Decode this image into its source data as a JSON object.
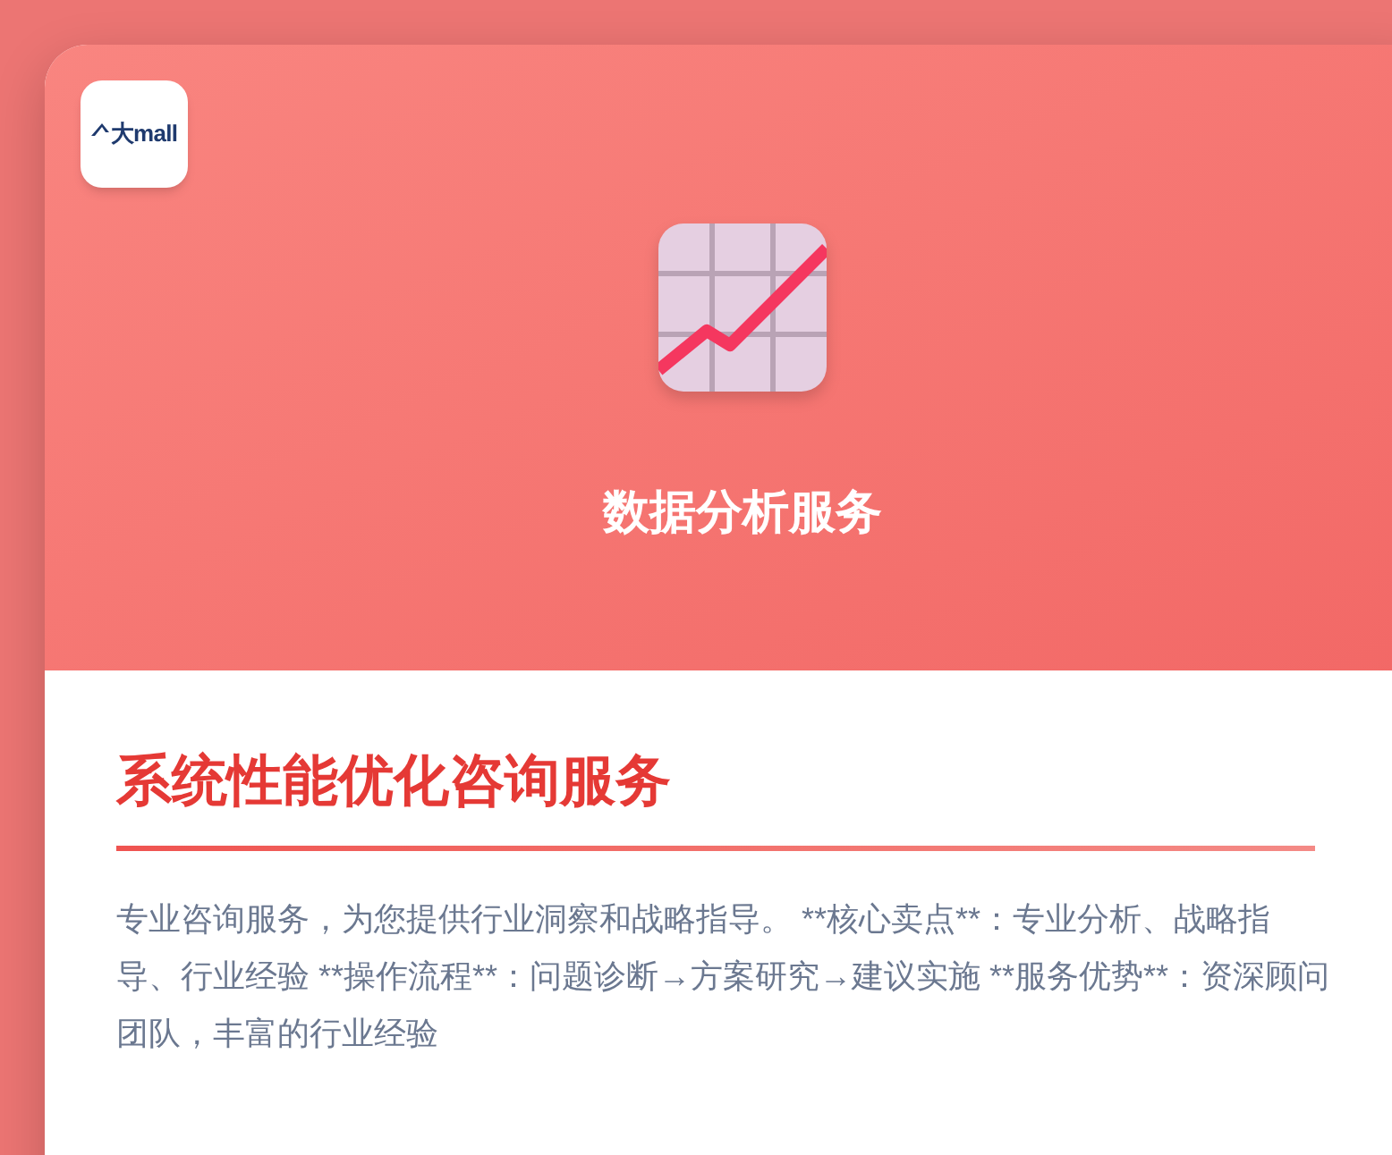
{
  "logo": {
    "text": "大mall"
  },
  "header": {
    "title": "数据分析服务"
  },
  "content": {
    "title": "系统性能优化咨询服务",
    "description": "专业咨询服务，为您提供行业洞察和战略指导。 **核心卖点**：专业分析、战略指导、行业经验 **操作流程**：问题诊断→方案研究→建议实施 **服务优势**：资深顾问团队，丰富的行业经验"
  }
}
